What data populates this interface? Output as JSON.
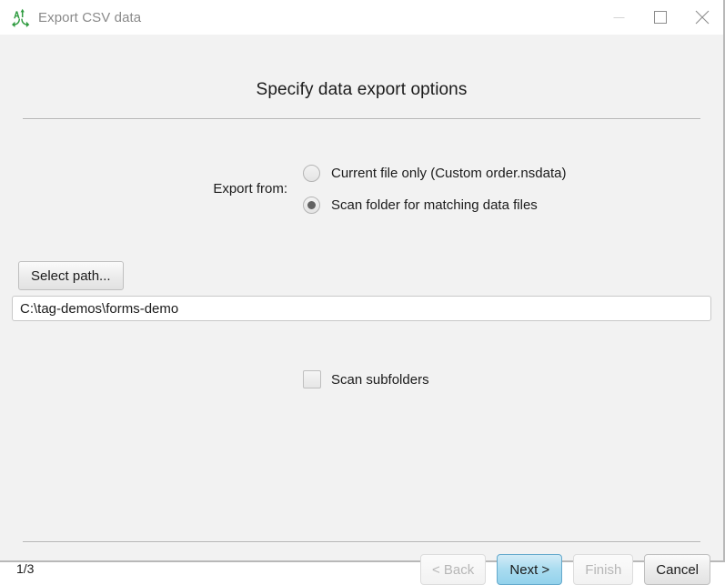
{
  "window": {
    "title": "Export CSV data",
    "app_icon": "sort-data-icon",
    "controls": [
      {
        "name": "minimize",
        "icon": "minimize-icon"
      },
      {
        "name": "maximize",
        "icon": "maximize-icon"
      },
      {
        "name": "close",
        "icon": "close-icon"
      }
    ]
  },
  "page": {
    "heading": "Specify data export options",
    "indicator": "1/3"
  },
  "export_from": {
    "label": "Export from:",
    "options": [
      {
        "label": "Current file only (Custom order.nsdata)",
        "selected": false
      },
      {
        "label": "Scan folder for matching data files",
        "selected": true
      }
    ]
  },
  "path": {
    "button_label": "Select path...",
    "value": "C:\\tag-demos\\forms-demo",
    "placeholder": ""
  },
  "subfolders": {
    "label": "Scan subfolders",
    "checked": false
  },
  "footer": {
    "back_label": "< Back",
    "next_label": "Next >",
    "finish_label": "Finish",
    "cancel_label": "Cancel"
  },
  "colors": {
    "window_bg": "#f2f2f2",
    "titlebar_bg": "#ffffff",
    "title_text": "#8a8a8a",
    "body_text": "#1b1b1b",
    "accent_primary": "#aadcf0",
    "accent_primary_border": "#64a9cc",
    "icon_green": "#2e9b3f",
    "disabled_text": "#b6b6b6",
    "rule": "#b0b0b0"
  }
}
